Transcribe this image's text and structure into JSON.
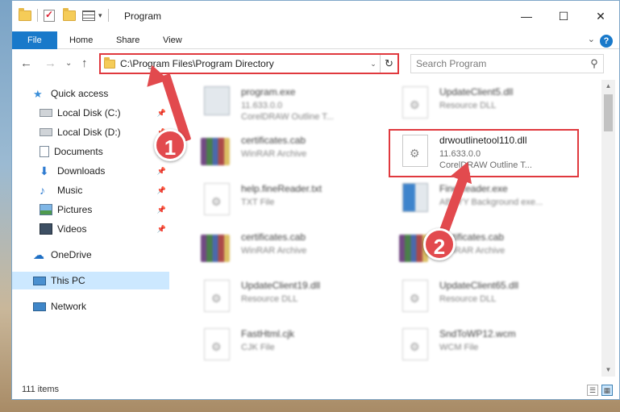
{
  "window": {
    "title": "Program",
    "controls": {
      "minimize": "—",
      "maximize": "☐",
      "close": "✕"
    }
  },
  "ribbon": {
    "tabs": [
      "File",
      "Home",
      "Share",
      "View"
    ],
    "help": "?",
    "collapse": "⌄"
  },
  "nav": {
    "back": "←",
    "forward": "→",
    "recent": "⌄",
    "up": "↑"
  },
  "address": {
    "path": "C:\\Program Files\\Program Directory",
    "dropdown": "⌄",
    "refresh": "↻"
  },
  "search": {
    "placeholder": "Search Program",
    "icon": "⚲"
  },
  "sidebar": {
    "items": [
      {
        "label": "Quick access",
        "icon": "star-icon"
      },
      {
        "label": "Local Disk (C:)",
        "icon": "drive-icon"
      },
      {
        "label": "Local Disk (D:)",
        "icon": "drive-icon"
      },
      {
        "label": "Documents",
        "icon": "documents-icon"
      },
      {
        "label": "Downloads",
        "icon": "download-icon"
      },
      {
        "label": "Music",
        "icon": "music-icon"
      },
      {
        "label": "Pictures",
        "icon": "pictures-icon"
      },
      {
        "label": "Videos",
        "icon": "videos-icon"
      },
      {
        "label": "OneDrive",
        "icon": "cloud-icon"
      },
      {
        "label": "This PC",
        "icon": "computer-icon"
      },
      {
        "label": "Network",
        "icon": "network-icon"
      }
    ],
    "pin": "📌"
  },
  "files": [
    {
      "name": "program.exe",
      "type": "11.633.0.0",
      "desc": "CorelDRAW Outline T...",
      "kind": "exe"
    },
    {
      "name": "UpdateClient5.dll",
      "type": "Resource DLL",
      "desc": "",
      "kind": "doc"
    },
    {
      "name": "certificates.cab",
      "type": "WinRAR Archive",
      "desc": "",
      "kind": "rar"
    },
    {
      "name": "drwoutlinetool110.dll",
      "type": "11.633.0.0",
      "desc": "CorelDRAW Outline T...",
      "kind": "doc"
    },
    {
      "name": "help.fineReader.txt",
      "type": "TXT File",
      "desc": "",
      "kind": "doc"
    },
    {
      "name": "FineReader.exe",
      "type": "ABBYY Background exe...",
      "desc": "",
      "kind": "exe"
    },
    {
      "name": "certificates.cab",
      "type": "WinRAR Archive",
      "desc": "",
      "kind": "rar"
    },
    {
      "name": "certificates.cab",
      "type": "WinRAR Archive",
      "desc": "",
      "kind": "rar"
    },
    {
      "name": "UpdateClient19.dll",
      "type": "Resource DLL",
      "desc": "",
      "kind": "doc"
    },
    {
      "name": "UpdateClient65.dll",
      "type": "Resource DLL",
      "desc": "",
      "kind": "doc"
    },
    {
      "name": "FastHtml.cjk",
      "type": "CJK File",
      "desc": "",
      "kind": "doc"
    },
    {
      "name": "SndToWP12.wcm",
      "type": "WCM File",
      "desc": "",
      "kind": "doc"
    }
  ],
  "status": {
    "items_count": "111 items"
  },
  "annotations": {
    "step1": "1",
    "step2": "2"
  },
  "colors": {
    "accent": "#1979ca",
    "highlight": "#e0393e",
    "selected": "#cce8ff"
  }
}
